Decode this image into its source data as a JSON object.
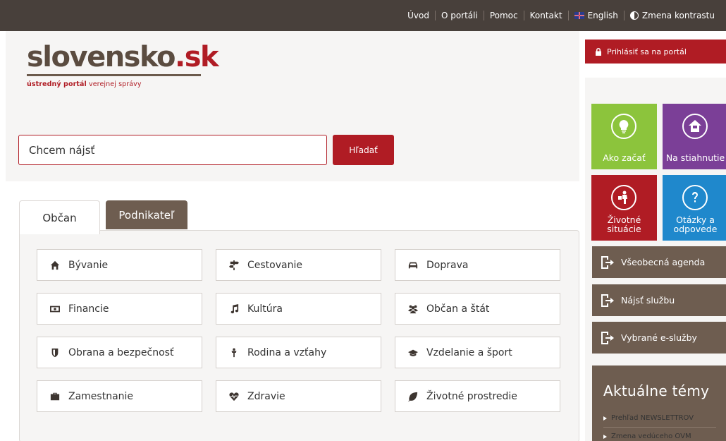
{
  "topnav": {
    "items": [
      "Úvod",
      "O portáli",
      "Pomoc",
      "Kontakt"
    ],
    "english": "English",
    "contrast": "Zmena kontrastu"
  },
  "logo": {
    "name_main": "slovensko",
    "name_tld": ".sk",
    "tagline_bold": "ústredný portál",
    "tagline_rest": " verejnej správy"
  },
  "search": {
    "placeholder": "Chcem nájsť",
    "button": "Hľadať"
  },
  "tabs": [
    {
      "label": "Občan",
      "active": true
    },
    {
      "label": "Podnikateľ",
      "active": false
    }
  ],
  "categories": [
    {
      "label": "Bývanie",
      "icon": "home-icon"
    },
    {
      "label": "Cestovanie",
      "icon": "signpost-icon"
    },
    {
      "label": "Doprava",
      "icon": "car-icon"
    },
    {
      "label": "Financie",
      "icon": "money-icon"
    },
    {
      "label": "Kultúra",
      "icon": "music-icon"
    },
    {
      "label": "Občan a štát",
      "icon": "group-icon"
    },
    {
      "label": "Obrana a bezpečnosť",
      "icon": "shield-icon"
    },
    {
      "label": "Rodina a vzťahy",
      "icon": "family-icon"
    },
    {
      "label": "Vzdelanie a šport",
      "icon": "graduation-cap-icon"
    },
    {
      "label": "Zamestnanie",
      "icon": "briefcase-icon"
    },
    {
      "label": "Zdravie",
      "icon": "heartbeat-icon"
    },
    {
      "label": "Životné prostredie",
      "icon": "leaf-icon"
    }
  ],
  "login": {
    "label": "Prihlásiť sa na portál"
  },
  "tiles": [
    {
      "label": "Ako začať",
      "color": "#8cc43c",
      "icon": "lightbulb-icon"
    },
    {
      "label": "Na stiahnutie",
      "color": "#7b3f97",
      "icon": "download-icon"
    },
    {
      "label_line1": "Životné",
      "label_line2": "situácie",
      "color": "#b01c24",
      "icon": "life-situations-icon"
    },
    {
      "label_line1": "Otázky a",
      "label_line2": "odpovede",
      "color": "#1f88cc",
      "icon": "question-icon"
    }
  ],
  "agenda": [
    "Všeobecná agenda",
    "Nájsť službu",
    "Vybrané e-služby"
  ],
  "topics": {
    "title": "Aktuálne témy",
    "items": [
      "Prehľad NEWSLETTROV",
      "Zmena vedúceho OVM"
    ]
  },
  "colors": {
    "topbar": "#48403b",
    "brand_red": "#b01c24",
    "brown": "#6e5d50",
    "panel_bg": "#f6f5f4"
  }
}
